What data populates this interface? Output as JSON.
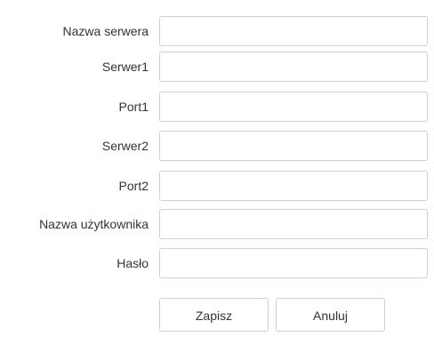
{
  "form": {
    "fields": [
      {
        "label": "Nazwa serwera",
        "value": ""
      },
      {
        "label": "Serwer1",
        "value": ""
      },
      {
        "label": "Port1",
        "value": ""
      },
      {
        "label": "Serwer2",
        "value": ""
      },
      {
        "label": "Port2",
        "value": ""
      },
      {
        "label": "Nazwa użytkownika",
        "value": ""
      },
      {
        "label": "Hasło",
        "value": ""
      }
    ],
    "save_label": "Zapisz",
    "cancel_label": "Anuluj"
  }
}
